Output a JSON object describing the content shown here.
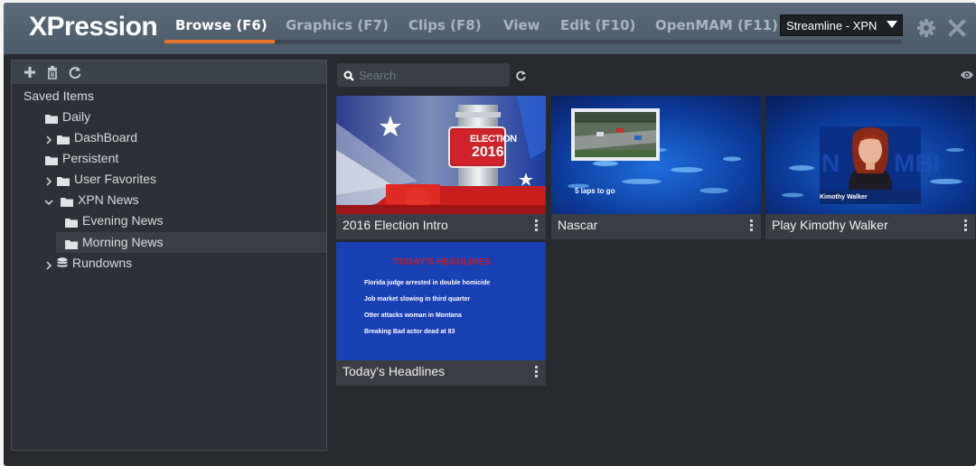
{
  "app": {
    "title": "XPression"
  },
  "tabs": [
    {
      "label": "Browse (F6)",
      "active": true
    },
    {
      "label": "Graphics (F7)",
      "active": false
    },
    {
      "label": "Clips (F8)",
      "active": false
    },
    {
      "label": "View",
      "active": false
    },
    {
      "label": "Edit (F10)",
      "active": false
    },
    {
      "label": "OpenMAM (F11)",
      "active": false
    }
  ],
  "workspace_select": {
    "value": "Streamline - XPN"
  },
  "header_icons": [
    "gear-icon",
    "close-icon"
  ],
  "tree_toolbar": [
    "plus-icon",
    "trash-icon",
    "refresh-icon"
  ],
  "tree": {
    "root": "Saved Items",
    "items": [
      {
        "label": "Daily",
        "icon": "folder-icon",
        "chevron": ""
      },
      {
        "label": "DashBoard",
        "icon": "folder-icon",
        "chevron": "collapsed"
      },
      {
        "label": "Persistent",
        "icon": "folder-icon",
        "chevron": ""
      },
      {
        "label": "User Favorites",
        "icon": "folder-icon",
        "chevron": "collapsed"
      },
      {
        "label": "XPN News",
        "icon": "folder-icon",
        "chevron": "expanded"
      },
      {
        "label": "Evening News",
        "icon": "folder-icon",
        "chevron": ""
      },
      {
        "label": "Morning News",
        "icon": "folder-icon",
        "chevron": "",
        "selected": true
      },
      {
        "label": "Rundowns",
        "icon": "database-icon",
        "chevron": "collapsed"
      }
    ]
  },
  "search": {
    "placeholder": "Search",
    "value": ""
  },
  "cards": [
    {
      "title": "2016 Election Intro",
      "thumb_text": [
        "ELECTION",
        "2016"
      ]
    },
    {
      "title": "Nascar",
      "thumb_text": [
        "5 laps to go"
      ]
    },
    {
      "title": "Play Kimothy Walker",
      "thumb_text": [
        "Kimothy Walker"
      ]
    },
    {
      "title": "Today's Headlines",
      "thumb_text": [
        "TODAY'S HEADLINES",
        "Florida judge arrested in double homicide",
        "Job market slowing in third quarter",
        "Otter attacks woman in Montana",
        "Breaking Bad actor dead at 83"
      ]
    }
  ],
  "colors": {
    "accent": "#e8752a",
    "header": "#55636f",
    "background": "#272a2f",
    "headline_red": "#d01818"
  }
}
